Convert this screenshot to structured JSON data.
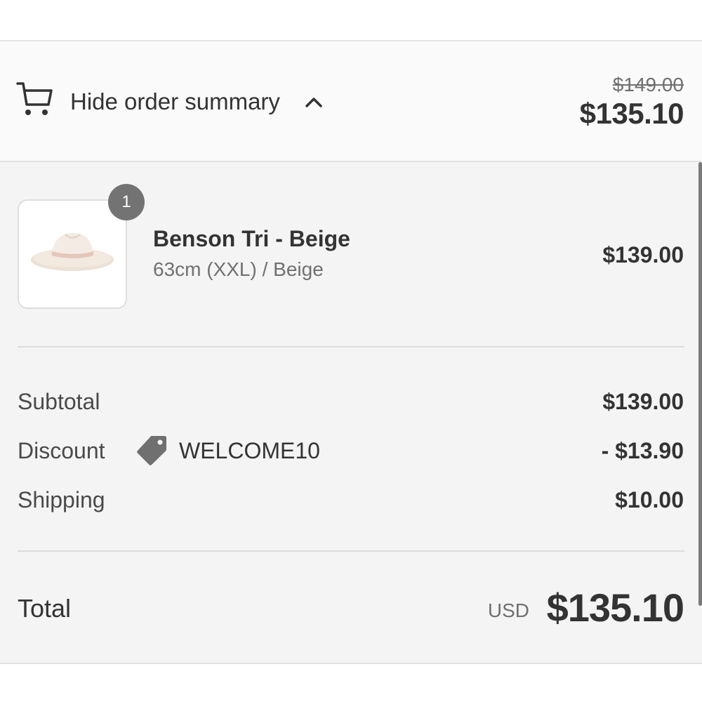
{
  "order_summary": {
    "toggle_label": "Hide order summary",
    "original_total": "$149.00",
    "total": "$135.10"
  },
  "line_item": {
    "quantity": "1",
    "name": "Benson Tri - Beige",
    "variant": "63cm (XXL) / Beige",
    "price": "$139.00"
  },
  "totals": {
    "subtotal_label": "Subtotal",
    "subtotal_value": "$139.00",
    "discount_label": "Discount",
    "discount_code": "WELCOME10",
    "discount_value": "- $13.90",
    "shipping_label": "Shipping",
    "shipping_value": "$10.00",
    "total_label": "Total",
    "currency": "USD",
    "total_value": "$135.10"
  },
  "icons": {
    "cart": "cart-icon",
    "chevron": "chevron-up-icon",
    "tag": "tag-icon"
  }
}
